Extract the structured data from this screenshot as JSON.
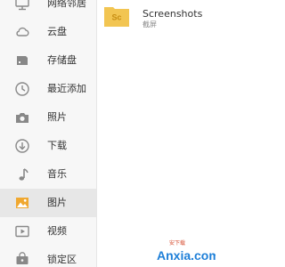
{
  "sidebar": {
    "items": [
      {
        "label": "网络邻居",
        "icon": "network-neighborhood-icon"
      },
      {
        "label": "云盘",
        "icon": "cloud-icon"
      },
      {
        "label": "存储盘",
        "icon": "storage-drive-icon"
      },
      {
        "label": "最近添加",
        "icon": "clock-icon"
      },
      {
        "label": "照片",
        "icon": "camera-icon"
      },
      {
        "label": "下载",
        "icon": "download-icon"
      },
      {
        "label": "音乐",
        "icon": "music-note-icon"
      },
      {
        "label": "图片",
        "icon": "image-icon",
        "selected": true
      },
      {
        "label": "视频",
        "icon": "video-icon"
      },
      {
        "label": "锁定区",
        "icon": "lock-icon"
      }
    ]
  },
  "main": {
    "folders": [
      {
        "badge": "Sc",
        "name": "Screenshots",
        "subtitle": "截屏"
      }
    ]
  },
  "watermark": {
    "en": "Anxia.com",
    "cn": "安下载"
  },
  "colors": {
    "folder": "#f2c552",
    "folder_badge": "#c78d12",
    "icon": "#888888",
    "selected_icon": "#f0a830",
    "watermark_blue": "#1e7fd8",
    "watermark_red": "#d64c2f"
  }
}
